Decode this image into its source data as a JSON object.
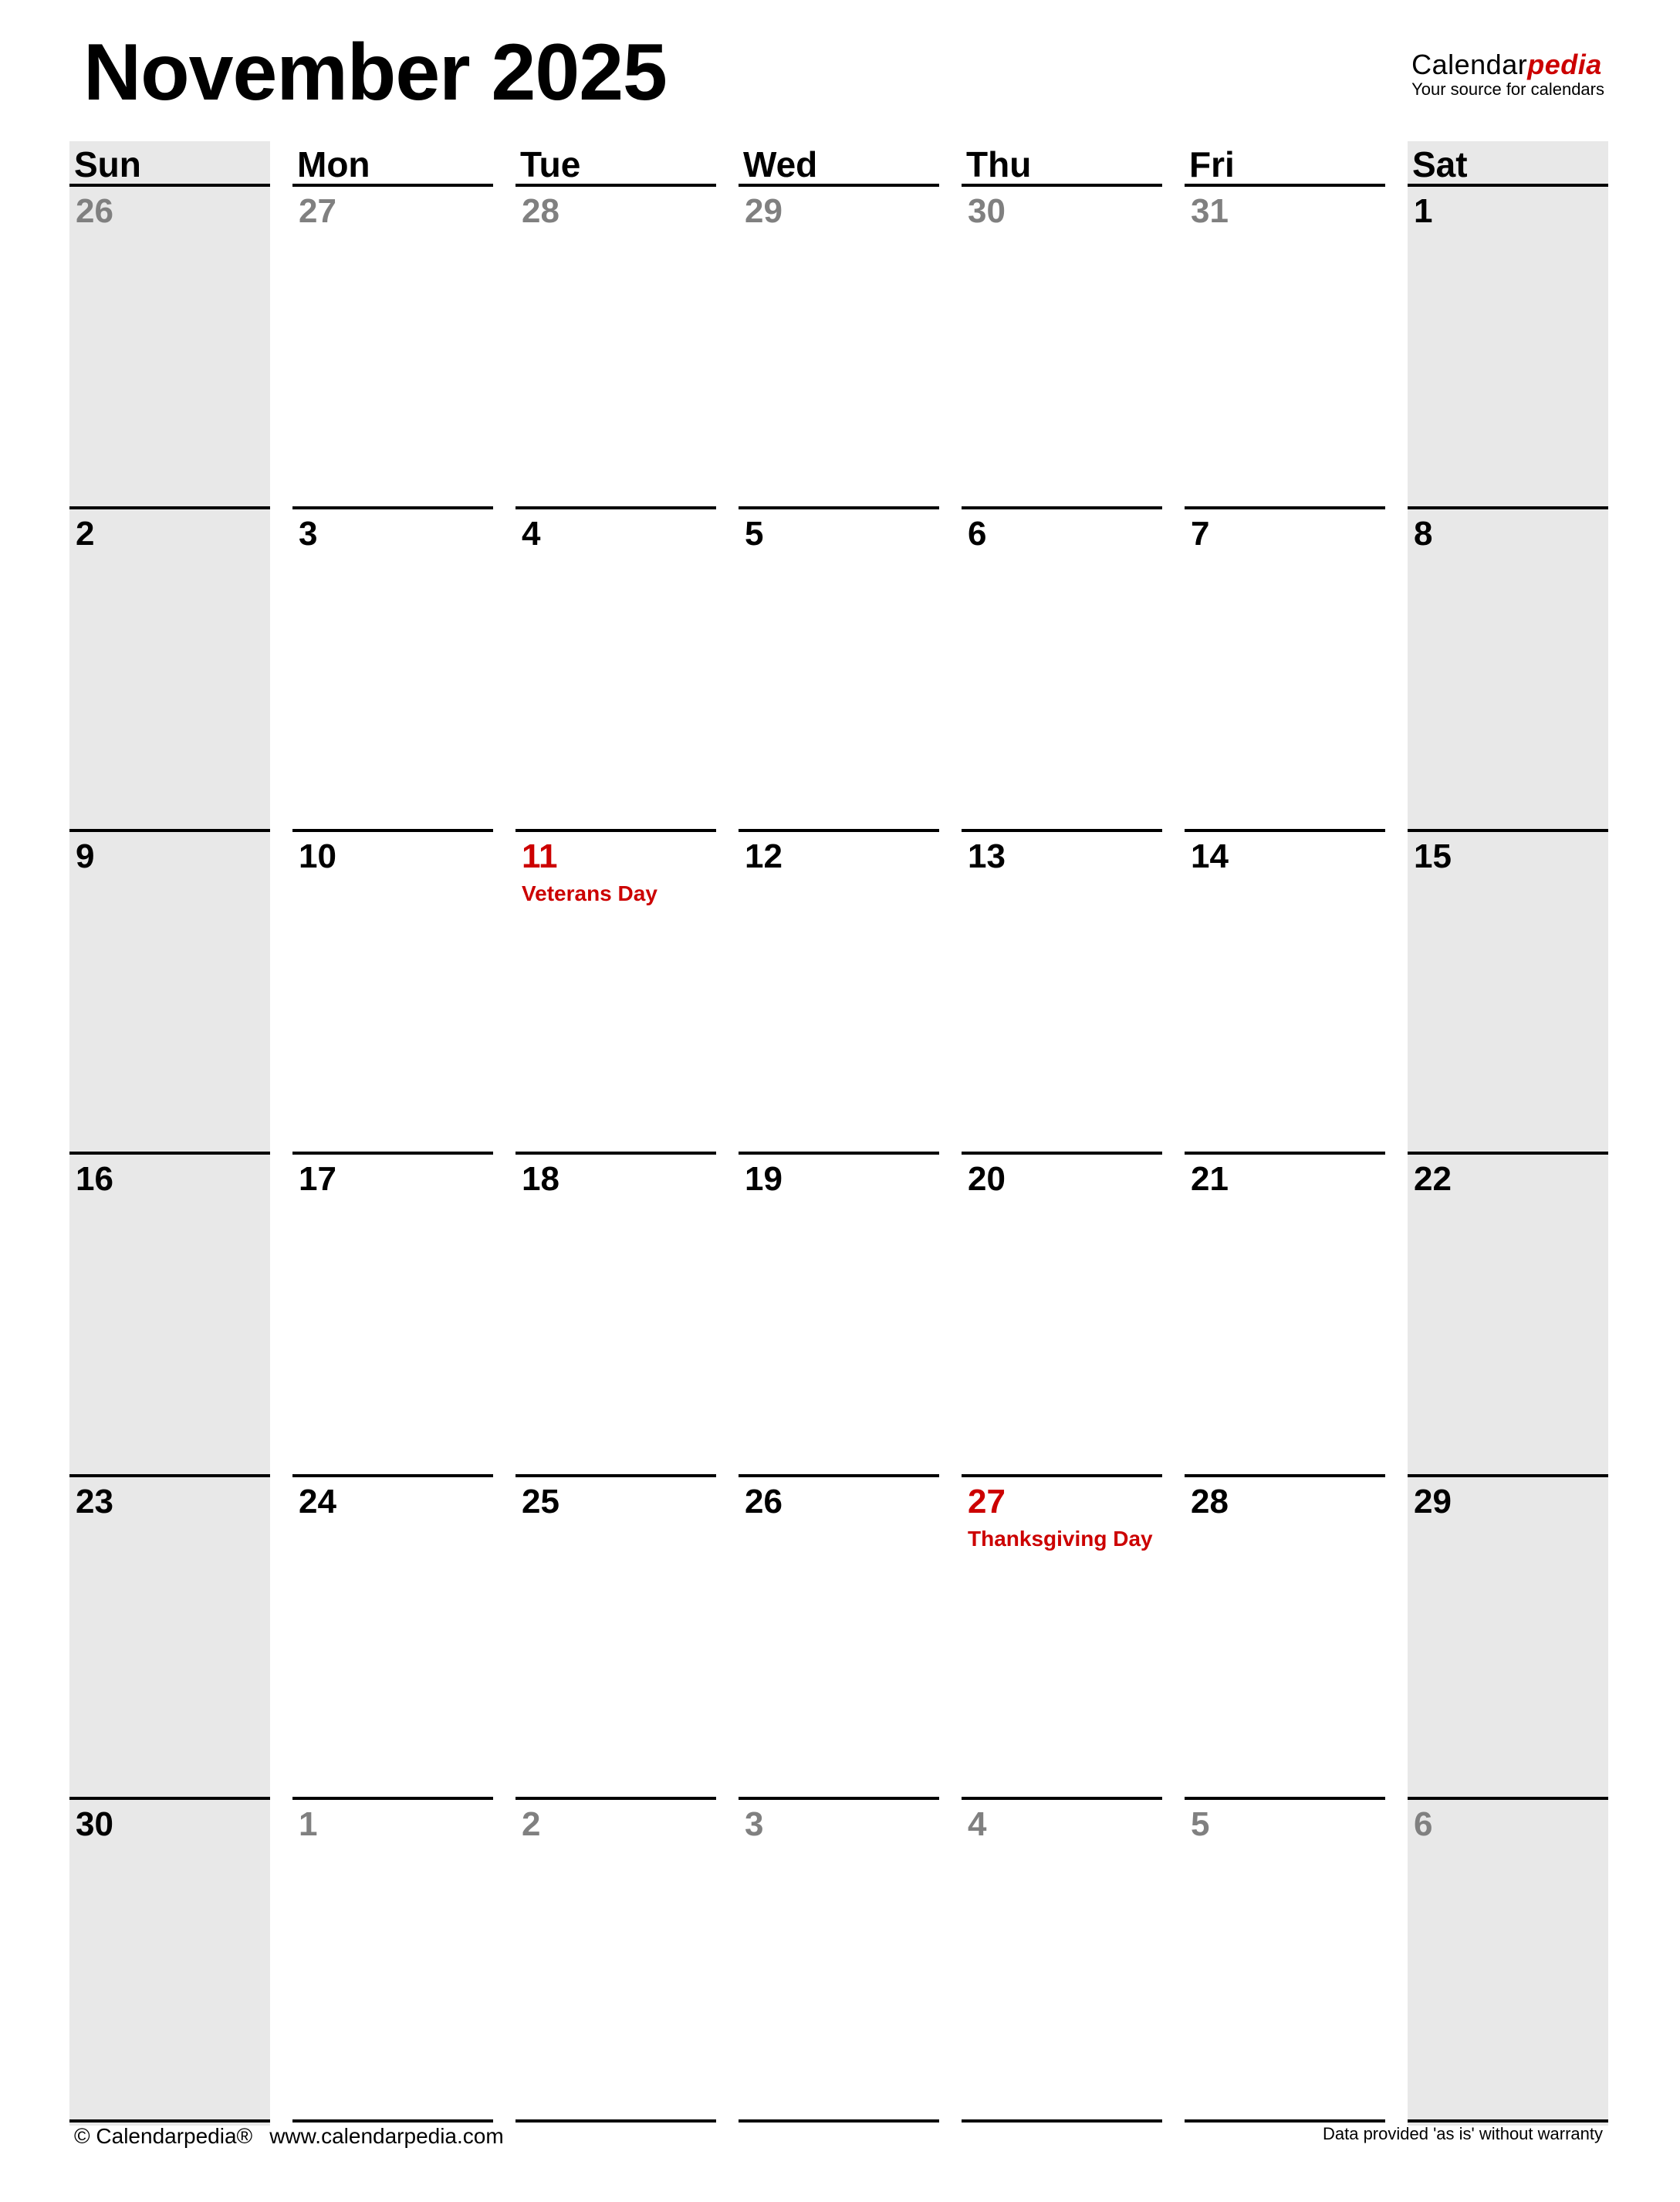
{
  "header": {
    "title": "November 2025",
    "brand": {
      "name_plain": "Calendar",
      "name_accent": "pedia",
      "tagline": "Your source for calendars",
      "accent_color": "#cc0000"
    }
  },
  "weekdays": [
    "Sun",
    "Mon",
    "Tue",
    "Wed",
    "Thu",
    "Fri",
    "Sat"
  ],
  "weeks": [
    [
      {
        "day": "26",
        "type": "other"
      },
      {
        "day": "27",
        "type": "other"
      },
      {
        "day": "28",
        "type": "other"
      },
      {
        "day": "29",
        "type": "other"
      },
      {
        "day": "30",
        "type": "other"
      },
      {
        "day": "31",
        "type": "other"
      },
      {
        "day": "1",
        "type": "current"
      }
    ],
    [
      {
        "day": "2",
        "type": "current"
      },
      {
        "day": "3",
        "type": "current"
      },
      {
        "day": "4",
        "type": "current"
      },
      {
        "day": "5",
        "type": "current"
      },
      {
        "day": "6",
        "type": "current"
      },
      {
        "day": "7",
        "type": "current"
      },
      {
        "day": "8",
        "type": "current"
      }
    ],
    [
      {
        "day": "9",
        "type": "current"
      },
      {
        "day": "10",
        "type": "current"
      },
      {
        "day": "11",
        "type": "holiday",
        "holiday": "Veterans Day"
      },
      {
        "day": "12",
        "type": "current"
      },
      {
        "day": "13",
        "type": "current"
      },
      {
        "day": "14",
        "type": "current"
      },
      {
        "day": "15",
        "type": "current"
      }
    ],
    [
      {
        "day": "16",
        "type": "current"
      },
      {
        "day": "17",
        "type": "current"
      },
      {
        "day": "18",
        "type": "current"
      },
      {
        "day": "19",
        "type": "current"
      },
      {
        "day": "20",
        "type": "current"
      },
      {
        "day": "21",
        "type": "current"
      },
      {
        "day": "22",
        "type": "current"
      }
    ],
    [
      {
        "day": "23",
        "type": "current"
      },
      {
        "day": "24",
        "type": "current"
      },
      {
        "day": "25",
        "type": "current"
      },
      {
        "day": "26",
        "type": "current"
      },
      {
        "day": "27",
        "type": "holiday",
        "holiday": "Thanksgiving Day"
      },
      {
        "day": "28",
        "type": "current"
      },
      {
        "day": "29",
        "type": "current"
      }
    ],
    [
      {
        "day": "30",
        "type": "current"
      },
      {
        "day": "1",
        "type": "other"
      },
      {
        "day": "2",
        "type": "other"
      },
      {
        "day": "3",
        "type": "other"
      },
      {
        "day": "4",
        "type": "other"
      },
      {
        "day": "5",
        "type": "other"
      },
      {
        "day": "6",
        "type": "other"
      }
    ]
  ],
  "colors": {
    "holiday": "#cc0000",
    "other_month": "#808080",
    "weekend_shade": "#e8e8e8"
  },
  "footer": {
    "copyright": "© Calendarpedia®",
    "website": "www.calendarpedia.com",
    "disclaimer": "Data provided 'as is' without warranty"
  }
}
